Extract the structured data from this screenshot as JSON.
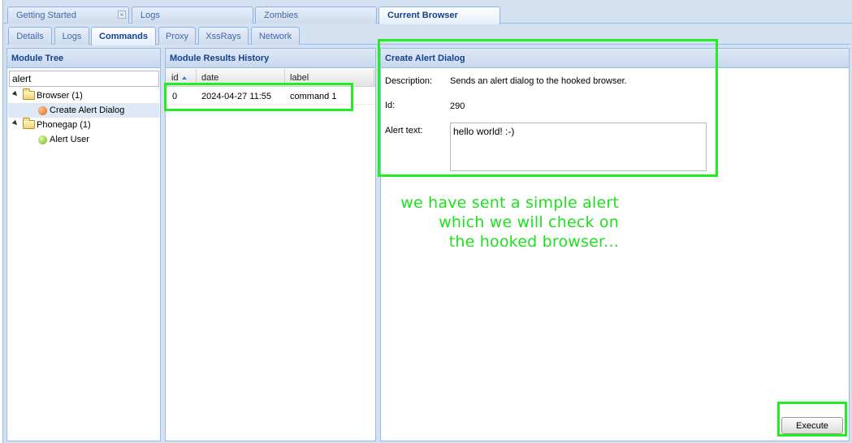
{
  "top_tabs": [
    {
      "label": "Getting Started",
      "closable": true
    },
    {
      "label": "Logs"
    },
    {
      "label": "Zombies"
    },
    {
      "label": "Current Browser",
      "active": true
    }
  ],
  "sub_tabs": [
    {
      "label": "Details"
    },
    {
      "label": "Logs"
    },
    {
      "label": "Commands",
      "active": true
    },
    {
      "label": "Proxy"
    },
    {
      "label": "XssRays"
    },
    {
      "label": "Network"
    }
  ],
  "module_tree": {
    "title": "Module Tree",
    "search_value": "alert",
    "nodes": [
      {
        "label": "Browser (1)",
        "type": "folder"
      },
      {
        "label": "Create Alert Dialog",
        "type": "module",
        "status_color": "#f08a3a",
        "selected": true
      },
      {
        "label": "Phonegap (1)",
        "type": "folder"
      },
      {
        "label": "Alert User",
        "type": "module",
        "status_color": "#9ed04c"
      }
    ]
  },
  "history": {
    "title": "Module Results History",
    "columns": [
      "id",
      "date",
      "label"
    ],
    "rows": [
      {
        "id": "0",
        "date": "2024-04-27 11:55",
        "label": "command 1"
      }
    ]
  },
  "dialog": {
    "title": "Create Alert Dialog",
    "description_label": "Description:",
    "description_value": "Sends an alert dialog to the hooked browser.",
    "id_label": "Id:",
    "id_value": "290",
    "alert_text_label": "Alert text:",
    "alert_text_value": "hello world! :-)",
    "execute_label": "Execute"
  },
  "annotation": {
    "lines": [
      "we have sent a simple alert",
      "which we will check on",
      "the hooked browser..."
    ],
    "color": "#22ee22"
  }
}
